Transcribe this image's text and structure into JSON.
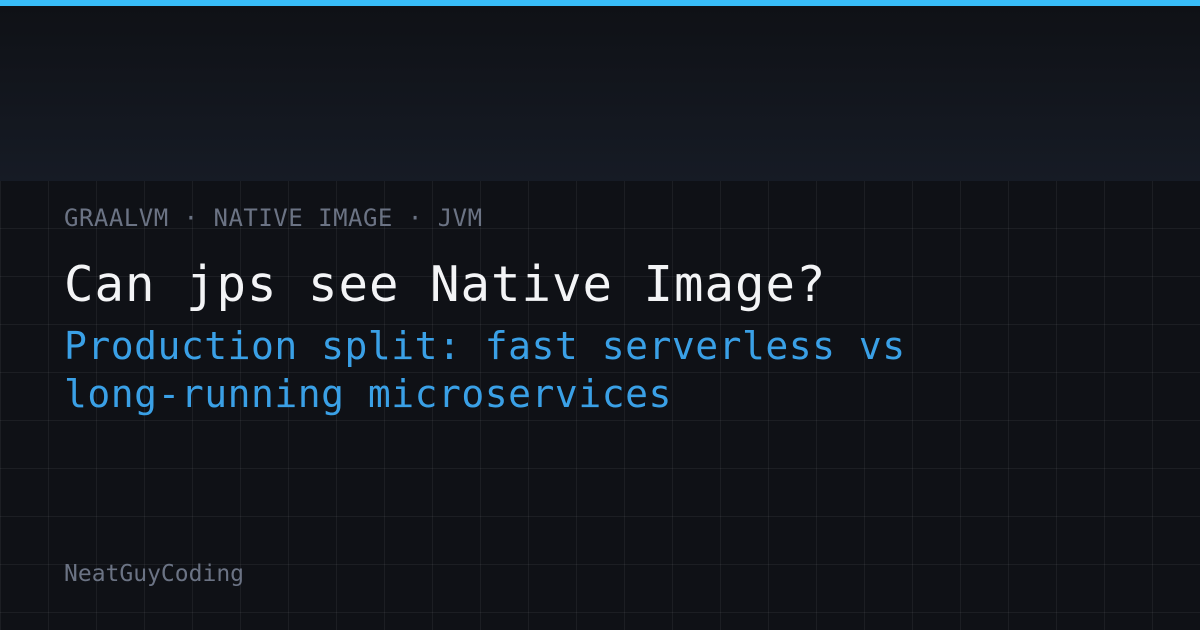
{
  "header": {
    "kicker": "GRAALVM · NATIVE IMAGE · JVM"
  },
  "main": {
    "title": "Can jps see Native Image?",
    "subtitle_line1": "Production split: fast serverless vs",
    "subtitle_line2": "long-running microservices"
  },
  "footer": {
    "brand": "NeatGuyCoding"
  },
  "colors": {
    "accent": "#38bdf8",
    "background": "#0f1116",
    "title": "#f3f4f6",
    "subtitle": "#3aa0e6",
    "muted": "#6b7384"
  }
}
